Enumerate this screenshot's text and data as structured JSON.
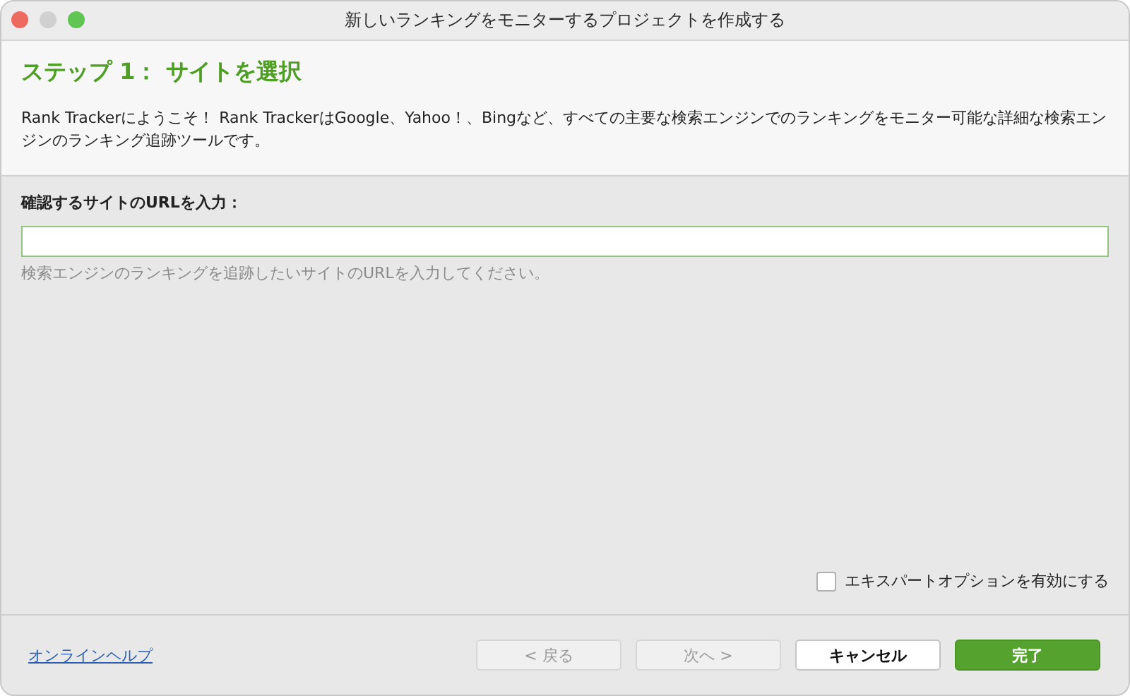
{
  "window": {
    "title": "新しいランキングをモニターするプロジェクトを作成する"
  },
  "header": {
    "step_title": "ステップ 1： サイトを選択",
    "description": "Rank Trackerにようこそ！ Rank TrackerはGoogle、Yahoo！、Bingなど、すべての主要な検索エンジンでのランキングをモニター可能な詳細な検索エンジンのランキング追跡ツールです。"
  },
  "url_field": {
    "label": "確認するサイトのURLを入力：",
    "hint": "検索エンジンのランキングを追跡したいサイトのURLを入力してください。"
  },
  "expert_option": {
    "label": "エキスパートオプションを有効にする",
    "checked": false
  },
  "footer": {
    "help_link": "オンラインヘルプ",
    "buttons": [
      {
        "label": "< 戻る",
        "kind": "secondary",
        "disabled": true
      },
      {
        "label": "次へ >",
        "kind": "secondary",
        "disabled": true
      },
      {
        "label": "キャンセル",
        "kind": "secondary",
        "disabled": false
      },
      {
        "label": "完了",
        "kind": "primary",
        "disabled": false
      }
    ]
  }
}
